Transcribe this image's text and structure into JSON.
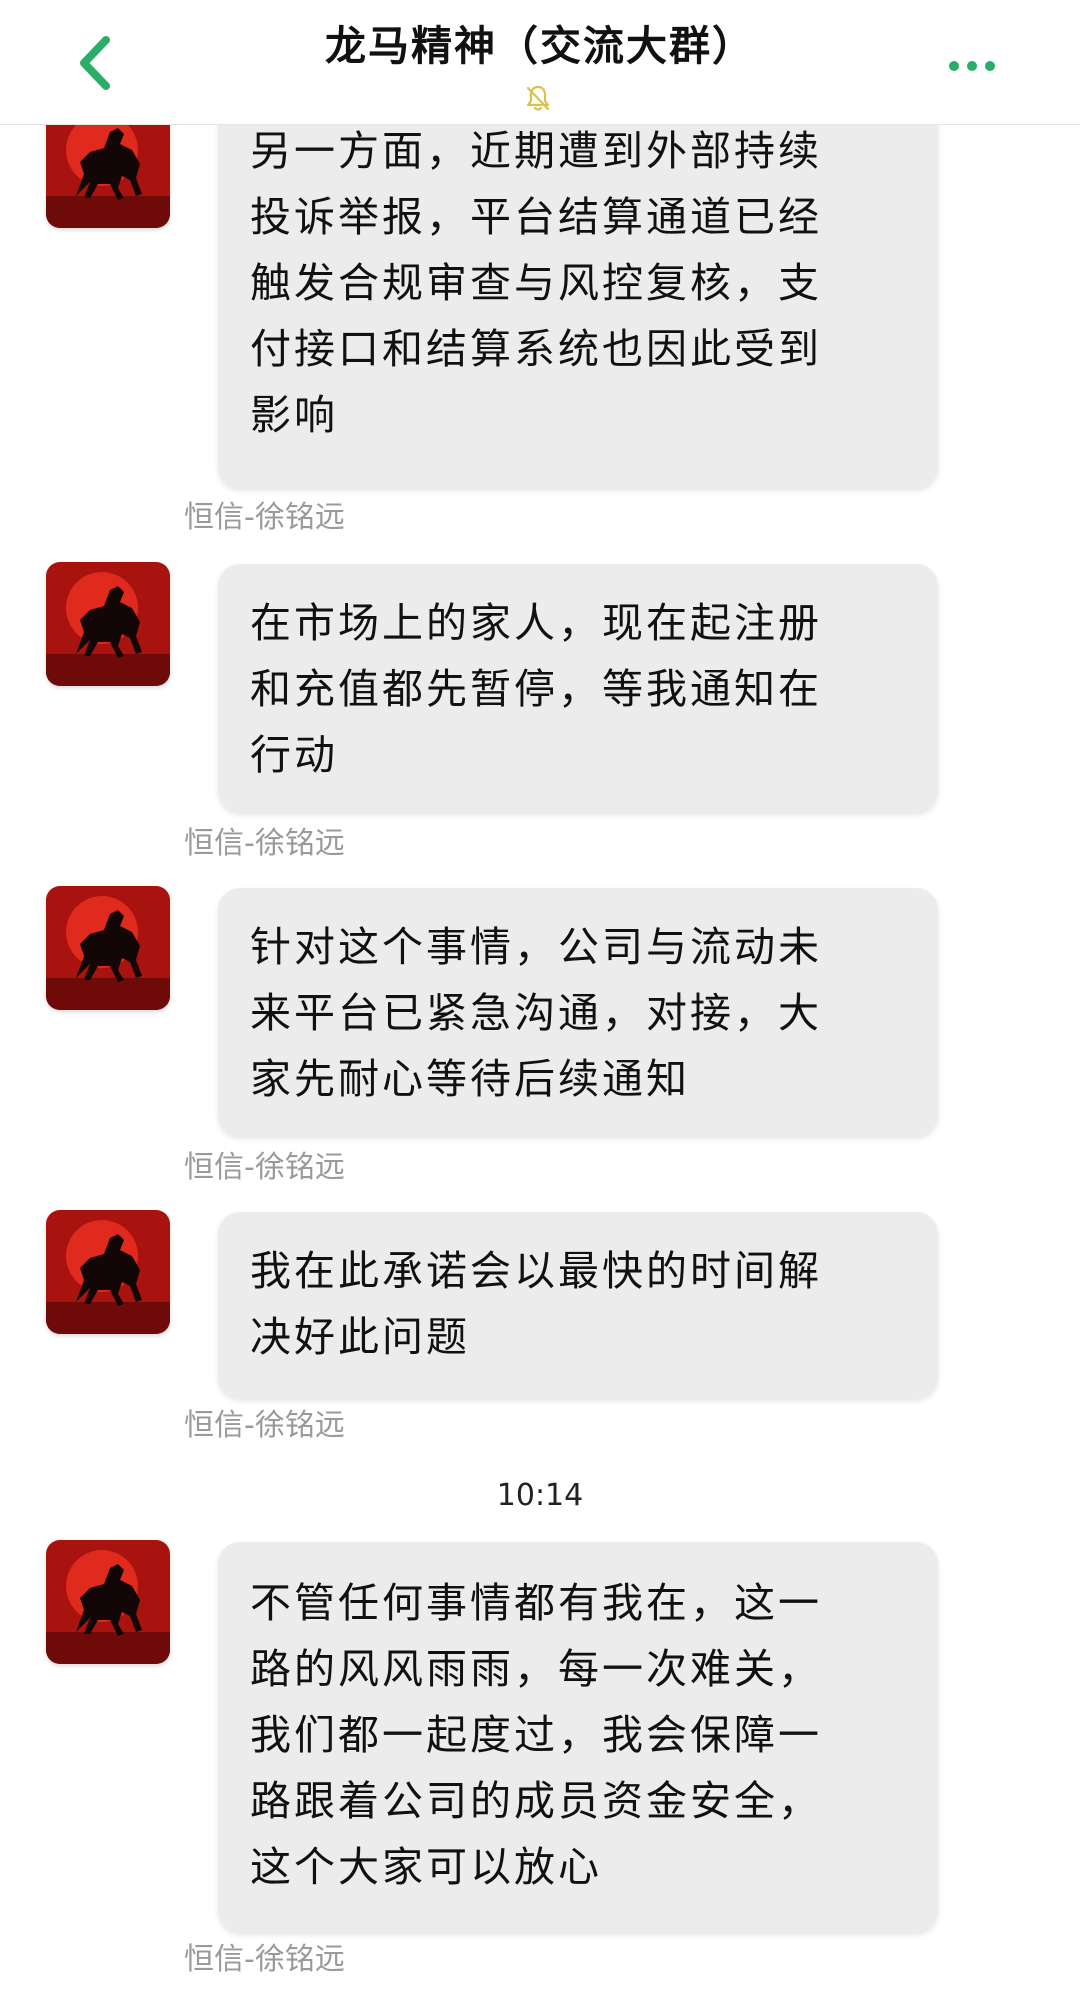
{
  "header": {
    "title": "龙马精神（交流大群）",
    "back_icon": "chevron-left-icon",
    "mute_icon": "bell-off-icon",
    "more_icon": "more-dots-icon",
    "accent_color": "#2aae67"
  },
  "messages": [
    {
      "text": "另一方面，近期遭到外部持续\n投诉举报，平台结算通道已经\n触发合规审查与风控复核，支\n付接口和结算系统也因此受到\n影响",
      "sender": "恒信-徐铭远"
    },
    {
      "text": "在市场上的家人，现在起注册\n和充值都先暂停，等我通知在\n行动",
      "sender": "恒信-徐铭远"
    },
    {
      "text": "针对这个事情，公司与流动未\n来平台已紧急沟通，对接，大\n家先耐心等待后续通知",
      "sender": "恒信-徐铭远"
    },
    {
      "text": "我在此承诺会以最快的时间解\n决好此问题",
      "sender": "恒信-徐铭远"
    },
    {
      "text": "不管任何事情都有我在，这一\n路的风风雨雨，每一次难关，\n我们都一起度过，我会保障一\n路跟着公司的成员资金安全，\n这个大家可以放心",
      "sender": "恒信-徐铭远"
    }
  ],
  "timestamp": "10:14"
}
